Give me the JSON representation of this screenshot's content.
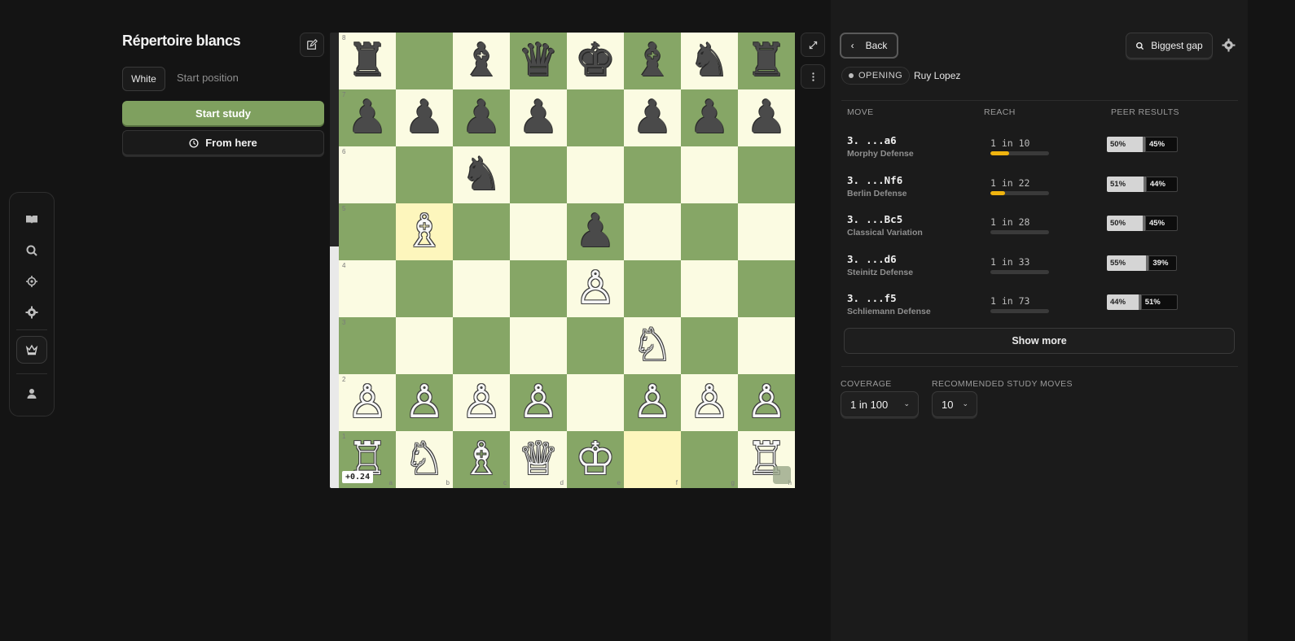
{
  "left": {
    "title": "Répertoire blancs",
    "color_chip": "White",
    "start_position": "Start position",
    "start_study": "Start study",
    "from_here": "From here"
  },
  "board": {
    "eval": "+0.24",
    "white_advantage_fraction": 0.53,
    "ranks": [
      "8",
      "7",
      "6",
      "5",
      "4",
      "3",
      "2",
      "1"
    ],
    "files": [
      "a",
      "b",
      "c",
      "d",
      "e",
      "f",
      "g",
      "h"
    ],
    "position": [
      [
        "r",
        "",
        "b",
        "q",
        "k",
        "b",
        "n",
        "r"
      ],
      [
        "p",
        "p",
        "p",
        "p",
        "",
        "p",
        "p",
        "p"
      ],
      [
        "",
        "",
        "n",
        "",
        "",
        "",
        "",
        ""
      ],
      [
        "",
        "B",
        "",
        "",
        "p",
        "",
        "",
        ""
      ],
      [
        "",
        "",
        "",
        "",
        "P",
        "",
        "",
        ""
      ],
      [
        "",
        "",
        "",
        "",
        "",
        "N",
        "",
        ""
      ],
      [
        "P",
        "P",
        "P",
        "P",
        "",
        "P",
        "P",
        "P"
      ],
      [
        "R",
        "N",
        "B",
        "Q",
        "K",
        "",
        "",
        "R"
      ]
    ],
    "highlighted": [
      "b5",
      "f1"
    ],
    "piece_colors": {
      "light_square": "#fbfbe2",
      "dark_square": "#86a666",
      "highlight": "#fdf6bd"
    }
  },
  "right": {
    "back": "Back",
    "biggest_gap": "Biggest gap",
    "opening_tag": "OPENING",
    "opening_name": "Ruy Lopez",
    "columns": {
      "move": "MOVE",
      "reach": "REACH",
      "peer": "PEER RESULTS"
    },
    "moves": [
      {
        "num": "3.",
        "san": "...a6",
        "name": "Morphy Defense",
        "reach": "1 in 10",
        "reach_fraction": 0.32,
        "white": "50%",
        "black": "45%"
      },
      {
        "num": "3.",
        "san": "...Nf6",
        "name": "Berlin Defense",
        "reach": "1 in 22",
        "reach_fraction": 0.25,
        "white": "51%",
        "black": "44%"
      },
      {
        "num": "3.",
        "san": "...Bc5",
        "name": "Classical Variation",
        "reach": "1 in 28",
        "reach_fraction": 0,
        "white": "50%",
        "black": "45%"
      },
      {
        "num": "3.",
        "san": "...d6",
        "name": "Steinitz Defense",
        "reach": "1 in 33",
        "reach_fraction": 0,
        "white": "55%",
        "black": "39%"
      },
      {
        "num": "3.",
        "san": "...f5",
        "name": "Schliemann Defense",
        "reach": "1 in 73",
        "reach_fraction": 0,
        "white": "44%",
        "black": "51%"
      }
    ],
    "show_more": "Show more",
    "coverage_label": "COVERAGE",
    "coverage_value": "1 in 100",
    "study_moves_label": "RECOMMENDED STUDY MOVES",
    "study_moves_value": "10",
    "accent": "#f0b40f"
  }
}
